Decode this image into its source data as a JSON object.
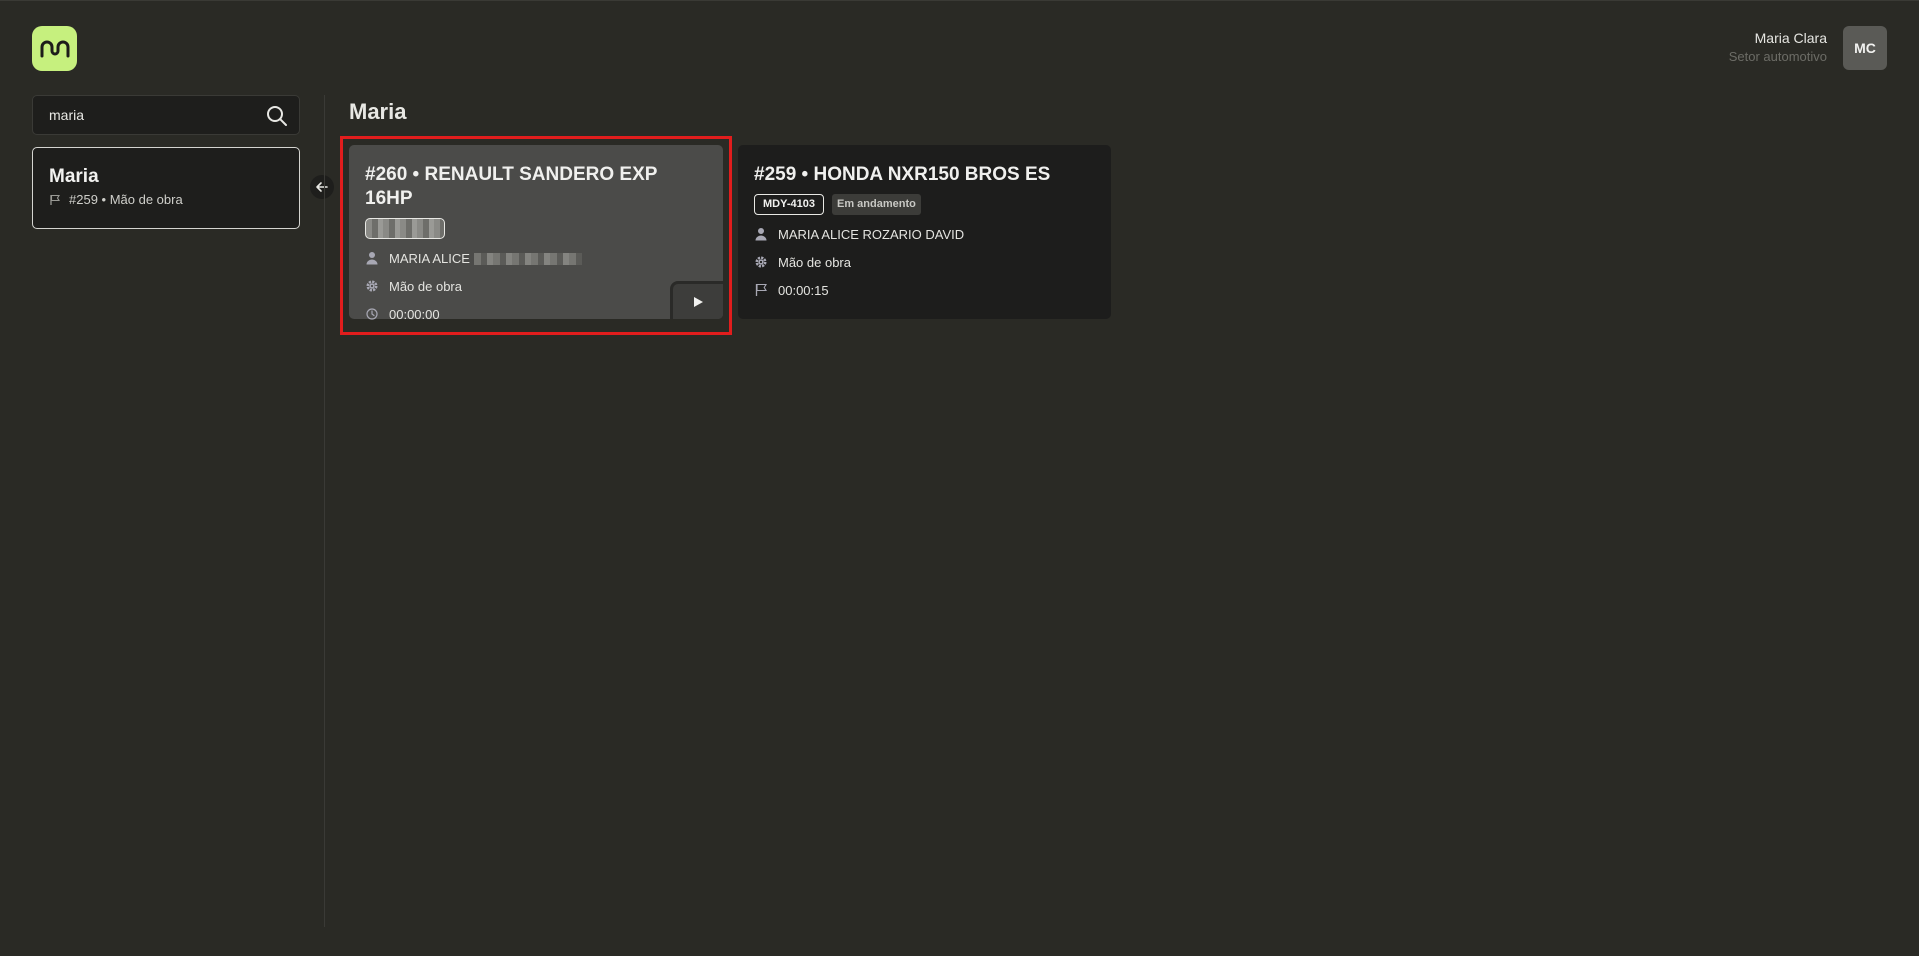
{
  "header": {
    "user_name": "Maria Clara",
    "user_role": "Setor automotivo",
    "avatar_initials": "MC",
    "logo_color": "#c6f07e"
  },
  "sidebar": {
    "search_value": "maria",
    "results": [
      {
        "title": "Maria",
        "subtitle": "#259 • Mão de obra"
      }
    ]
  },
  "main": {
    "title": "Maria",
    "cards": [
      {
        "title": "#260 • RENAULT SANDERO EXP 16HP",
        "plate": "",
        "customer": "MARIA ALICE",
        "service": "Mão de obra",
        "time": "00:00:00",
        "selected": true
      },
      {
        "title": "#259 • HONDA NXR150 BROS ES",
        "plate": "MDY-4103",
        "status": "Em andamento",
        "customer": "MARIA ALICE ROZARIO DAVID",
        "service": "Mão de obra",
        "time": "00:00:15"
      }
    ]
  },
  "colors": {
    "background": "#2a2a25",
    "highlight": "#e11d1d"
  }
}
